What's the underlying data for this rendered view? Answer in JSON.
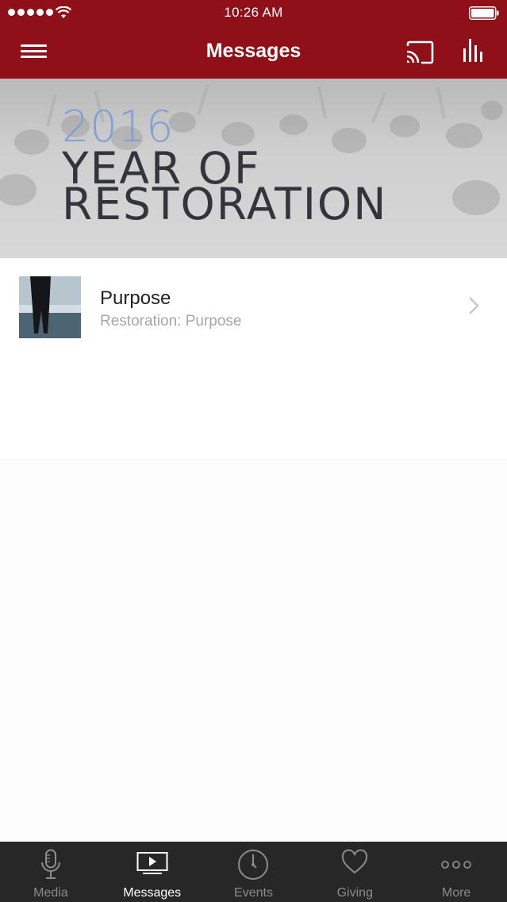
{
  "status_bar": {
    "time": "10:26 AM"
  },
  "nav": {
    "title": "Messages"
  },
  "banner": {
    "year": "2016",
    "line1": "YEAR OF",
    "line2": "RESTORATION"
  },
  "messages": [
    {
      "title": "Purpose",
      "subtitle": "Restoration: Purpose"
    }
  ],
  "tabs": [
    {
      "label": "Media",
      "icon": "microphone-icon",
      "active": false
    },
    {
      "label": "Messages",
      "icon": "play-screen-icon",
      "active": true
    },
    {
      "label": "Events",
      "icon": "clock-icon",
      "active": false
    },
    {
      "label": "Giving",
      "icon": "heart-icon",
      "active": false
    },
    {
      "label": "More",
      "icon": "more-dots-icon",
      "active": false
    }
  ],
  "colors": {
    "header": "#8f1018",
    "tabbar": "#272727",
    "year_accent": "#7e9fd6"
  }
}
